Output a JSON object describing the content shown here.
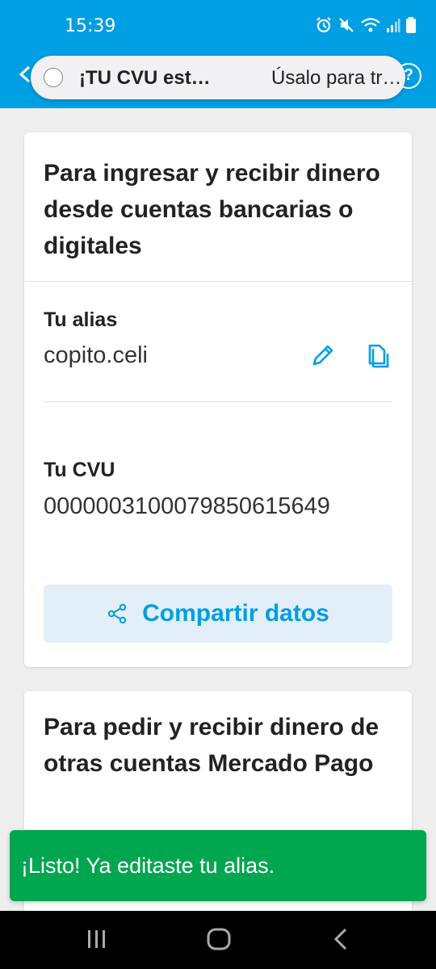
{
  "status_bar": {
    "time": "15:39",
    "icons": [
      "alarm-icon",
      "mute-icon",
      "wifi-icon",
      "signal-icon",
      "battery-icon"
    ]
  },
  "notification": {
    "title": "¡TU CVU est…",
    "body": "Úsalo para tr…"
  },
  "card1": {
    "title": "Para ingresar y recibir dinero desde cuentas bancarias o digitales",
    "alias_label": "Tu alias",
    "alias_value": "copito.celi",
    "cvu_label": "Tu CVU",
    "cvu_value": "0000003100079850615649",
    "share_button": "Compartir datos"
  },
  "card2": {
    "title": "Para pedir y recibir dinero de otras cuentas Mercado Pago"
  },
  "toast": {
    "message": "¡Listo! Ya editaste tu alias."
  },
  "colors": {
    "brand_blue": "#009ee3",
    "success_green": "#00a650",
    "share_bg": "#e3eff8"
  }
}
